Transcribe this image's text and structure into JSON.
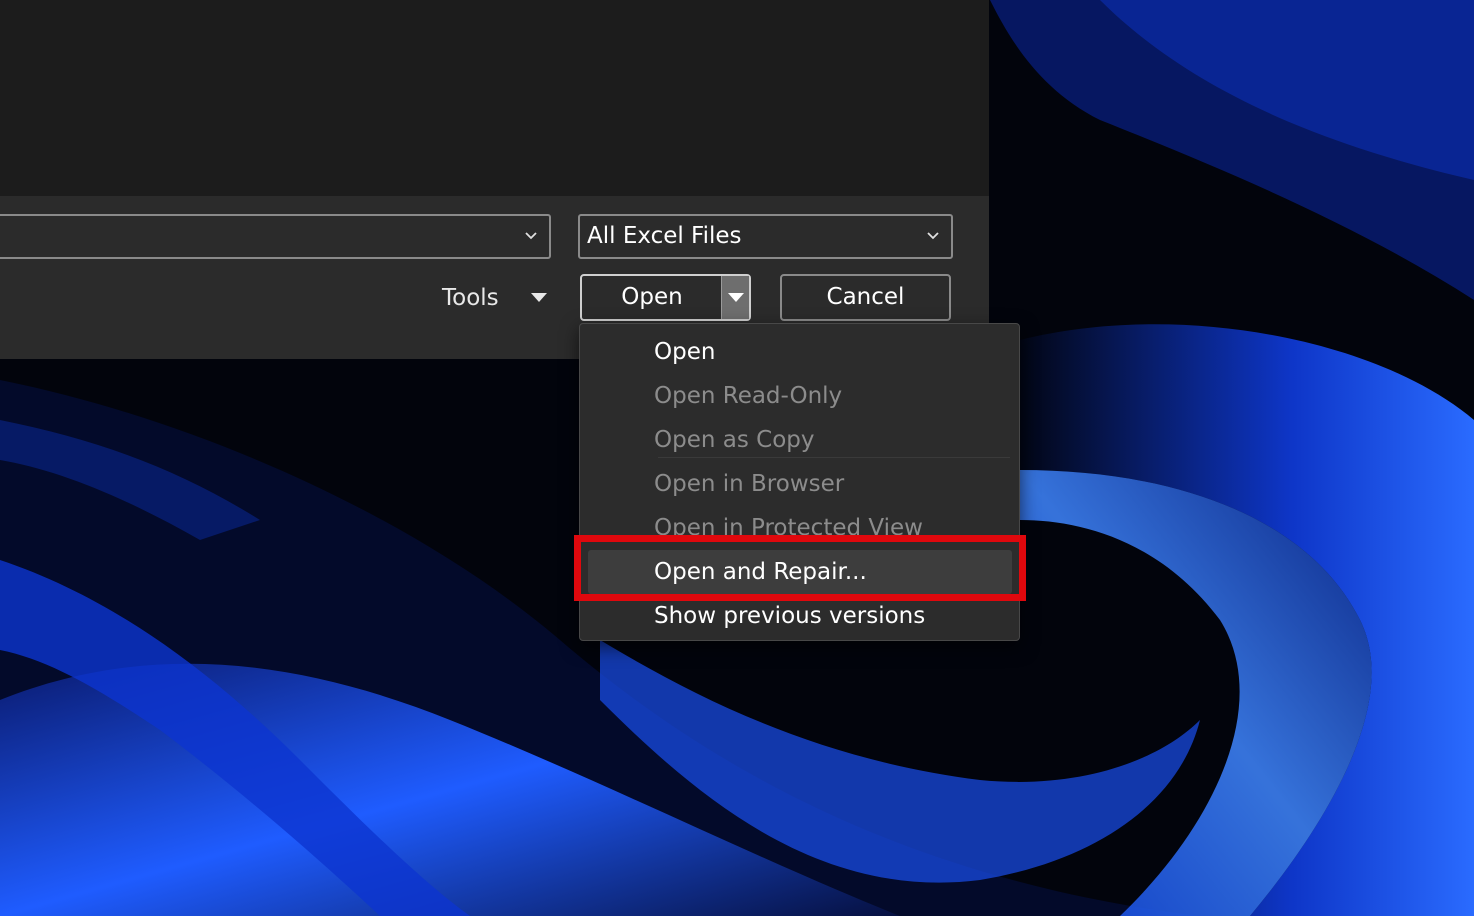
{
  "dialog": {
    "file_name_value": "",
    "file_type_selected": "All Excel Files",
    "tools_label": "Tools",
    "open_label": "Open",
    "cancel_label": "Cancel"
  },
  "open_menu": {
    "items": [
      {
        "label": "Open",
        "enabled": true
      },
      {
        "label": "Open Read-Only",
        "enabled": false
      },
      {
        "label": "Open as Copy",
        "enabled": false
      },
      {
        "label": "Open in Browser",
        "enabled": false
      },
      {
        "label": "Open in Protected View",
        "enabled": false
      },
      {
        "label": "Open and Repair...",
        "enabled": true,
        "hovered": true,
        "highlighted": true
      },
      {
        "label": "Show previous versions",
        "enabled": true
      }
    ]
  },
  "colors": {
    "dialog_bg": "#2b2b2b",
    "file_list_bg": "#1c1c1c",
    "menu_bg": "#2c2c2c",
    "highlight_box": "#e0080d",
    "wallpaper_accent": "#1f5cff"
  },
  "icons": {
    "dropdown": "chevron-down-icon",
    "caret": "caret-down-icon"
  }
}
